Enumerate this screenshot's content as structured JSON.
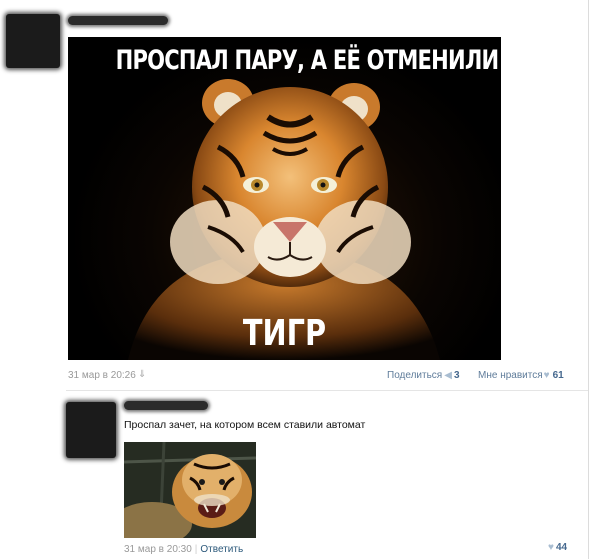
{
  "post": {
    "meme": {
      "top_caption": "ПРОСПАЛ ПАРУ, А ЕЁ ОТМЕНИЛИ",
      "bottom_caption": "ТИГР",
      "image": "tiger-portrait"
    },
    "date": "31 мар в 20:26",
    "share_label": "Поделиться",
    "share_count": "3",
    "like_label": "Мне нравится",
    "like_count": "61"
  },
  "comment": {
    "text": "Проспал зачет, на котором всем ставили автомат",
    "image": "tiger-photo",
    "date": "31 мар в 20:30",
    "separator": "|",
    "reply_label": "Ответить",
    "like_count": "44"
  },
  "colors": {
    "link": "#2b587a",
    "count": "#45688e",
    "meta": "#999999",
    "icon": "#a9bdd1"
  }
}
